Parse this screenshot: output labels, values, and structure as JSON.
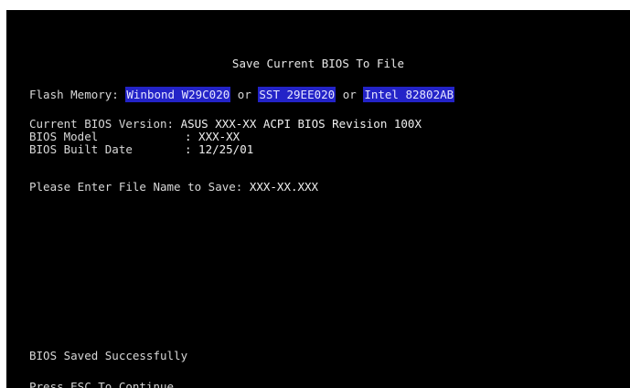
{
  "screen": {
    "title": "Save Current BIOS To File",
    "flash_memory": {
      "label": "Flash Memory:",
      "chips": [
        "Winbond W29C020",
        "SST 29EE020",
        "Intel 82802AB"
      ],
      "separator": "or"
    },
    "bios_info": {
      "version_label": "Current BIOS Version:",
      "version_value": "ASUS XXX-XX ACPI BIOS Revision 100X",
      "model_label": "BIOS Model",
      "model_value": ": XXX-XX",
      "date_label": "BIOS Built Date",
      "date_value": ": 12/25/01"
    },
    "prompt": {
      "label": "Please Enter File Name to Save:",
      "value": "XXX-XX.XXX"
    },
    "status": "BIOS Saved Successfully",
    "continue_hint": "Press ESC To Continue"
  },
  "colors": {
    "background": "#000000",
    "text": "#d8d8d8",
    "highlight": "#2323c8"
  }
}
